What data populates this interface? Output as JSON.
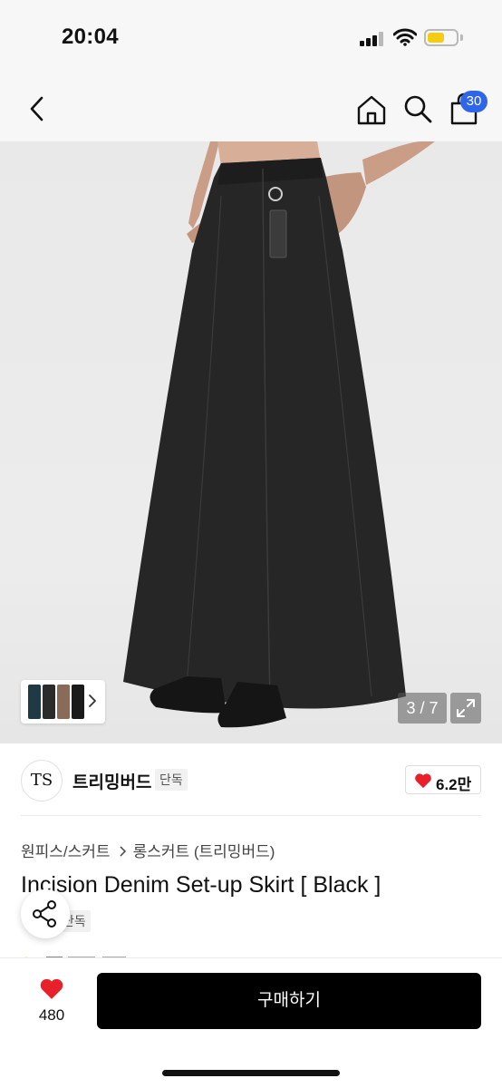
{
  "status_bar": {
    "time": "20:04",
    "icons": [
      "signal-icon",
      "wifi-icon",
      "battery-icon"
    ],
    "battery_color": "#f5cc14"
  },
  "nav": {
    "icons": [
      "chevron-left-icon",
      "home-icon",
      "search-icon",
      "shopping-bag-icon"
    ],
    "cart_count": "30",
    "badge_color": "#2f66e8"
  },
  "gallery": {
    "page_indicator": "3 / 7",
    "current_page": 3,
    "total_pages": 7,
    "thumb_colors": [
      "#1f3a44",
      "#2b2b2b",
      "#8a6a58",
      "#1a1a1a"
    ]
  },
  "brand": {
    "logo_text": "TS",
    "name": "트리밍버드",
    "tag": "단독",
    "like_count": "6.2만",
    "heart_color": "#e8202a"
  },
  "product": {
    "breadcrumb": [
      "원피스/스커트",
      "롱스커트 (트리밍버드)"
    ],
    "title": "Incision Denim Set-up Skirt [ Black ]",
    "tag": "단독"
  },
  "bottom_bar": {
    "like_count": "480",
    "buy_label": "구매하기"
  }
}
